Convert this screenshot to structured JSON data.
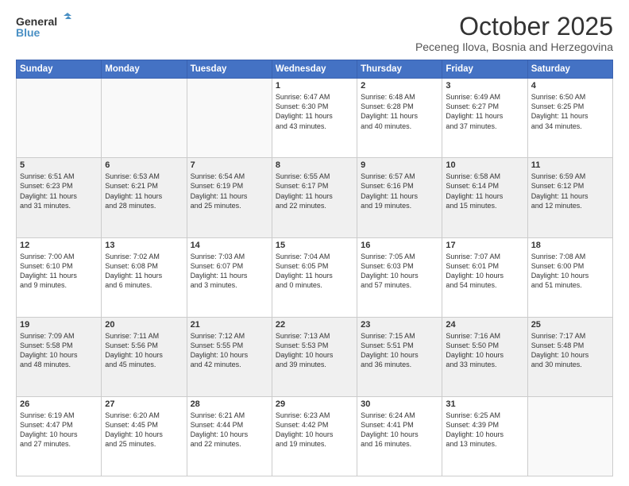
{
  "header": {
    "logo_line1": "General",
    "logo_line2": "Blue",
    "title": "October 2025",
    "subtitle": "Peceneg Ilova, Bosnia and Herzegovina"
  },
  "columns": [
    "Sunday",
    "Monday",
    "Tuesday",
    "Wednesday",
    "Thursday",
    "Friday",
    "Saturday"
  ],
  "weeks": [
    [
      {
        "day": "",
        "info": ""
      },
      {
        "day": "",
        "info": ""
      },
      {
        "day": "",
        "info": ""
      },
      {
        "day": "1",
        "info": "Sunrise: 6:47 AM\nSunset: 6:30 PM\nDaylight: 11 hours\nand 43 minutes."
      },
      {
        "day": "2",
        "info": "Sunrise: 6:48 AM\nSunset: 6:28 PM\nDaylight: 11 hours\nand 40 minutes."
      },
      {
        "day": "3",
        "info": "Sunrise: 6:49 AM\nSunset: 6:27 PM\nDaylight: 11 hours\nand 37 minutes."
      },
      {
        "day": "4",
        "info": "Sunrise: 6:50 AM\nSunset: 6:25 PM\nDaylight: 11 hours\nand 34 minutes."
      }
    ],
    [
      {
        "day": "5",
        "info": "Sunrise: 6:51 AM\nSunset: 6:23 PM\nDaylight: 11 hours\nand 31 minutes."
      },
      {
        "day": "6",
        "info": "Sunrise: 6:53 AM\nSunset: 6:21 PM\nDaylight: 11 hours\nand 28 minutes."
      },
      {
        "day": "7",
        "info": "Sunrise: 6:54 AM\nSunset: 6:19 PM\nDaylight: 11 hours\nand 25 minutes."
      },
      {
        "day": "8",
        "info": "Sunrise: 6:55 AM\nSunset: 6:17 PM\nDaylight: 11 hours\nand 22 minutes."
      },
      {
        "day": "9",
        "info": "Sunrise: 6:57 AM\nSunset: 6:16 PM\nDaylight: 11 hours\nand 19 minutes."
      },
      {
        "day": "10",
        "info": "Sunrise: 6:58 AM\nSunset: 6:14 PM\nDaylight: 11 hours\nand 15 minutes."
      },
      {
        "day": "11",
        "info": "Sunrise: 6:59 AM\nSunset: 6:12 PM\nDaylight: 11 hours\nand 12 minutes."
      }
    ],
    [
      {
        "day": "12",
        "info": "Sunrise: 7:00 AM\nSunset: 6:10 PM\nDaylight: 11 hours\nand 9 minutes."
      },
      {
        "day": "13",
        "info": "Sunrise: 7:02 AM\nSunset: 6:08 PM\nDaylight: 11 hours\nand 6 minutes."
      },
      {
        "day": "14",
        "info": "Sunrise: 7:03 AM\nSunset: 6:07 PM\nDaylight: 11 hours\nand 3 minutes."
      },
      {
        "day": "15",
        "info": "Sunrise: 7:04 AM\nSunset: 6:05 PM\nDaylight: 11 hours\nand 0 minutes."
      },
      {
        "day": "16",
        "info": "Sunrise: 7:05 AM\nSunset: 6:03 PM\nDaylight: 10 hours\nand 57 minutes."
      },
      {
        "day": "17",
        "info": "Sunrise: 7:07 AM\nSunset: 6:01 PM\nDaylight: 10 hours\nand 54 minutes."
      },
      {
        "day": "18",
        "info": "Sunrise: 7:08 AM\nSunset: 6:00 PM\nDaylight: 10 hours\nand 51 minutes."
      }
    ],
    [
      {
        "day": "19",
        "info": "Sunrise: 7:09 AM\nSunset: 5:58 PM\nDaylight: 10 hours\nand 48 minutes."
      },
      {
        "day": "20",
        "info": "Sunrise: 7:11 AM\nSunset: 5:56 PM\nDaylight: 10 hours\nand 45 minutes."
      },
      {
        "day": "21",
        "info": "Sunrise: 7:12 AM\nSunset: 5:55 PM\nDaylight: 10 hours\nand 42 minutes."
      },
      {
        "day": "22",
        "info": "Sunrise: 7:13 AM\nSunset: 5:53 PM\nDaylight: 10 hours\nand 39 minutes."
      },
      {
        "day": "23",
        "info": "Sunrise: 7:15 AM\nSunset: 5:51 PM\nDaylight: 10 hours\nand 36 minutes."
      },
      {
        "day": "24",
        "info": "Sunrise: 7:16 AM\nSunset: 5:50 PM\nDaylight: 10 hours\nand 33 minutes."
      },
      {
        "day": "25",
        "info": "Sunrise: 7:17 AM\nSunset: 5:48 PM\nDaylight: 10 hours\nand 30 minutes."
      }
    ],
    [
      {
        "day": "26",
        "info": "Sunrise: 6:19 AM\nSunset: 4:47 PM\nDaylight: 10 hours\nand 27 minutes."
      },
      {
        "day": "27",
        "info": "Sunrise: 6:20 AM\nSunset: 4:45 PM\nDaylight: 10 hours\nand 25 minutes."
      },
      {
        "day": "28",
        "info": "Sunrise: 6:21 AM\nSunset: 4:44 PM\nDaylight: 10 hours\nand 22 minutes."
      },
      {
        "day": "29",
        "info": "Sunrise: 6:23 AM\nSunset: 4:42 PM\nDaylight: 10 hours\nand 19 minutes."
      },
      {
        "day": "30",
        "info": "Sunrise: 6:24 AM\nSunset: 4:41 PM\nDaylight: 10 hours\nand 16 minutes."
      },
      {
        "day": "31",
        "info": "Sunrise: 6:25 AM\nSunset: 4:39 PM\nDaylight: 10 hours\nand 13 minutes."
      },
      {
        "day": "",
        "info": ""
      }
    ]
  ]
}
